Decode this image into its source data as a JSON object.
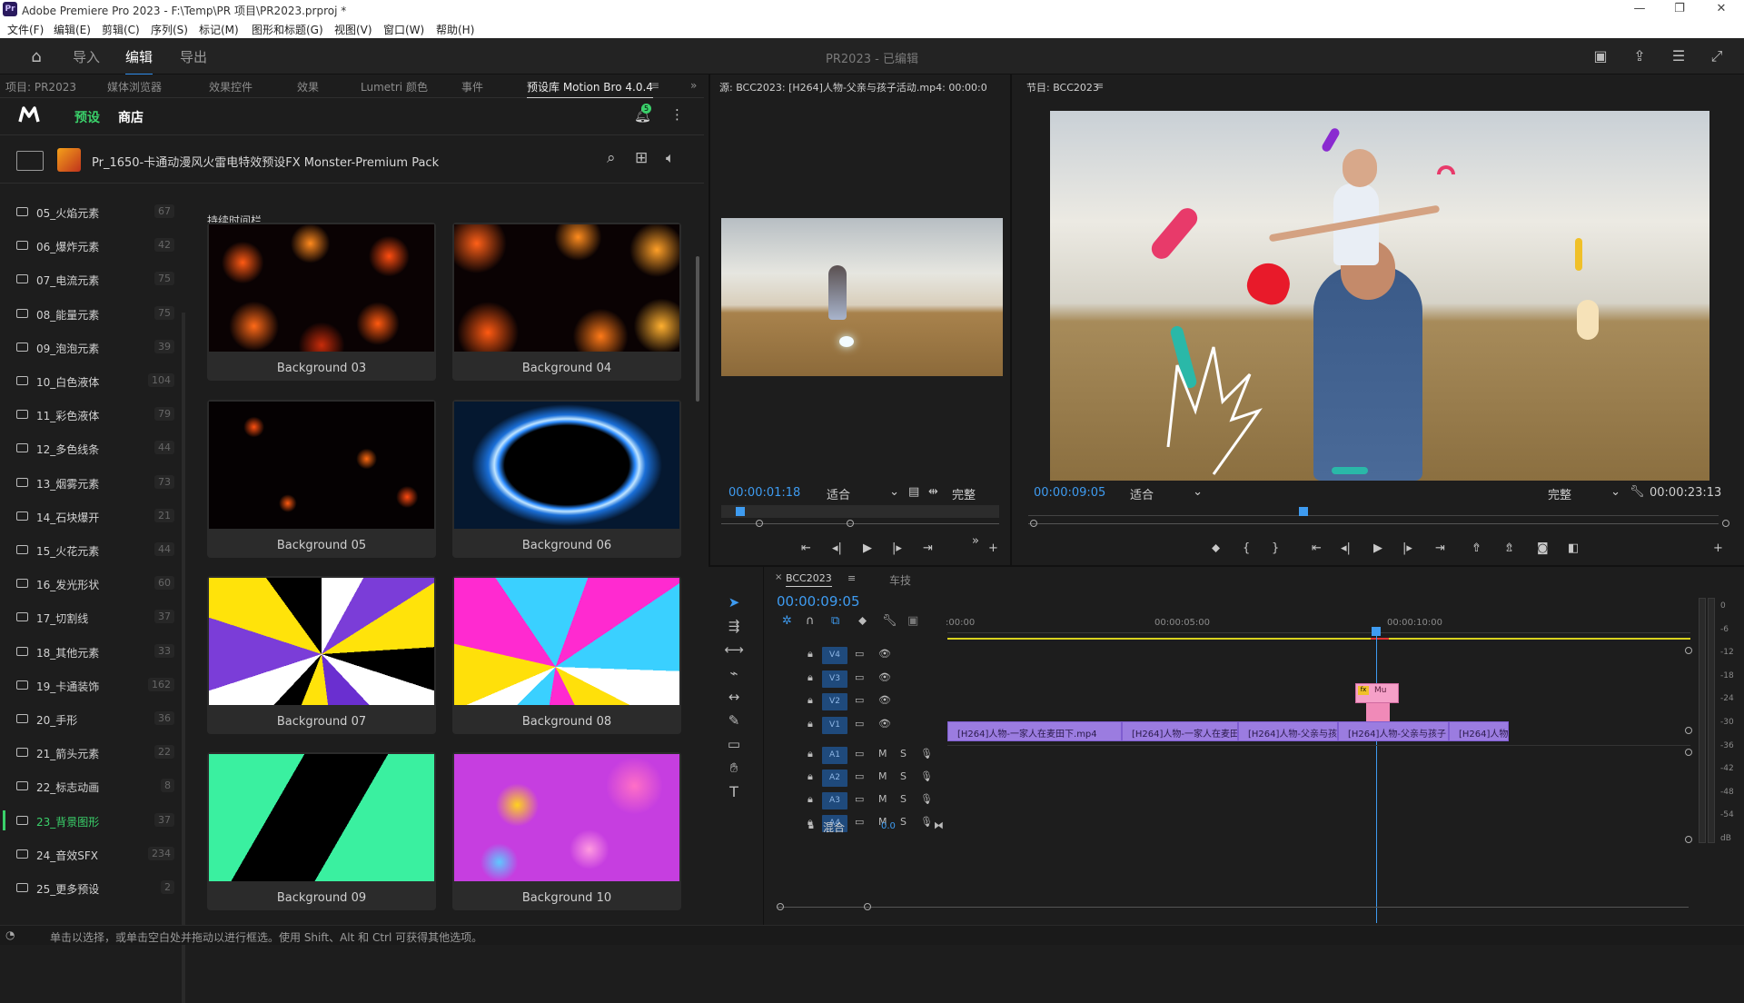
{
  "titlebar": {
    "logo": "Pr",
    "title": "Adobe Premiere Pro 2023 - F:\\Temp\\PR 项目\\PR2023.prproj *"
  },
  "menu": [
    "文件(F)",
    "编辑(E)",
    "剪辑(C)",
    "序列(S)",
    "标记(M)",
    "图形和标题(G)",
    "视图(V)",
    "窗口(W)",
    "帮助(H)"
  ],
  "workspace": {
    "tabs": [
      "导入",
      "编辑",
      "导出"
    ],
    "active": "编辑",
    "project_status": "PR2023 - 已编辑"
  },
  "left_tabs": [
    "项目: PR2023",
    "媒体浏览器",
    "效果控件",
    "效果",
    "Lumetri 颜色",
    "事件",
    "预设库 Motion Bro 4.0.4"
  ],
  "motionbro": {
    "tab_presets": "预设",
    "tab_store": "商店",
    "notif_count": "5",
    "pack_name": "Pr_1650-卡通动漫风火雷电特效预设FX Monster-Premium Pack",
    "section_label": "持续时间栏"
  },
  "categories": [
    {
      "name": "05_火焰元素",
      "count": "67"
    },
    {
      "name": "06_爆炸元素",
      "count": "42"
    },
    {
      "name": "07_电流元素",
      "count": "75"
    },
    {
      "name": "08_能量元素",
      "count": "75"
    },
    {
      "name": "09_泡泡元素",
      "count": "39"
    },
    {
      "name": "10_白色液体",
      "count": "104"
    },
    {
      "name": "11_彩色液体",
      "count": "79"
    },
    {
      "name": "12_多色线条",
      "count": "44"
    },
    {
      "name": "13_烟雾元素",
      "count": "73"
    },
    {
      "name": "14_石块爆开",
      "count": "21"
    },
    {
      "name": "15_火花元素",
      "count": "44"
    },
    {
      "name": "16_发光形状",
      "count": "60"
    },
    {
      "name": "17_切割线",
      "count": "37"
    },
    {
      "name": "18_其他元素",
      "count": "33"
    },
    {
      "name": "19_卡通装饰",
      "count": "162"
    },
    {
      "name": "20_手形",
      "count": "36"
    },
    {
      "name": "21_箭头元素",
      "count": "22"
    },
    {
      "name": "22_标志动画",
      "count": "8"
    },
    {
      "name": "23_背景图形",
      "count": "37"
    },
    {
      "name": "24_音效SFX",
      "count": "234"
    },
    {
      "name": "25_更多预设",
      "count": "2"
    }
  ],
  "selected_category": "23_背景图形",
  "thumbs": [
    "Background 03",
    "Background 04",
    "Background 05",
    "Background 06",
    "Background 07",
    "Background 08",
    "Background 09",
    "Background 10"
  ],
  "source": {
    "title": "源: BCC2023: [H264]人物-父亲与孩子活动.mp4: 00:00:0",
    "timecode": "00:00:01:18",
    "fit": "适合",
    "quality": "完整"
  },
  "program": {
    "title": "节目: BCC2023",
    "timecode": "00:00:09:05",
    "fit": "适合",
    "quality": "完整",
    "duration": "00:00:23:13"
  },
  "timeline": {
    "seq_tab": "BCC2023",
    "other_tab": "车技",
    "timecode": "00:00:09:05",
    "ruler": [
      ":00:00",
      "00:00:05:00",
      "00:00:10:00"
    ],
    "video_tracks": [
      "V4",
      "V3",
      "V2",
      "V1"
    ],
    "audio_tracks": [
      "A1",
      "A2",
      "A3",
      "A4"
    ],
    "mix_label": "混合",
    "mix_value": "0.0",
    "clips": [
      "[H264]人物-一家人在麦田下.mp4",
      "[H264]人物-一家人在麦田",
      "[H264]人物-父亲与孩",
      "[H264]人物-父亲与孩子",
      "[H264]人物"
    ],
    "fx_clip": "Mu"
  },
  "meter_labels": [
    "0",
    "-6",
    "-12",
    "-18",
    "-24",
    "-30",
    "-36",
    "-42",
    "-48",
    "-54",
    "dB"
  ],
  "status": "单击以选择，或单击空白处并拖动以进行框选。使用 Shift、Alt 和 Ctrl 可获得其他选项。"
}
